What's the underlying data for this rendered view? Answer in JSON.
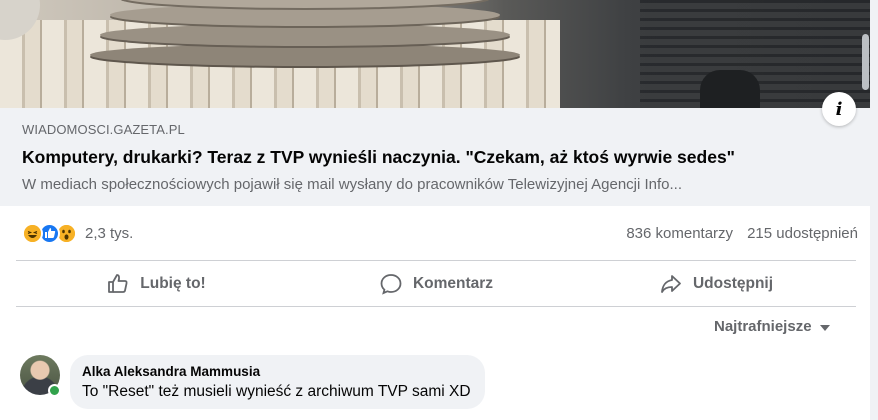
{
  "link_preview": {
    "domain": "WIADOMOSCI.GAZETA.PL",
    "title": "Komputery, drukarki? Teraz z TVP wynieśli naczynia. \"Czekam, aż ktoś wyrwie sedes\"",
    "description": "W mediach społecznościowych pojawił się mail wysłany do pracowników Telewizyjnej Agencji Info...",
    "info_icon": "info-icon"
  },
  "reactions": {
    "icons": [
      "haha-icon",
      "like-icon",
      "wow-icon"
    ],
    "count": "2,3 tys.",
    "comments": "836 komentarzy",
    "shares": "215 udostępnień"
  },
  "actions": {
    "like_label": "Lubię to!",
    "comment_label": "Komentarz",
    "share_label": "Udostępnij"
  },
  "sort": {
    "label": "Najtrafniejsze"
  },
  "comment": {
    "author": "Alka Aleksandra Mammusia",
    "text": "To \"Reset\" też musieli wynieść z archiwum TVP sami XD"
  },
  "colors": {
    "accent": "#1877f2",
    "secondary_text": "#65676b",
    "bubble": "#f0f2f5",
    "online": "#31a24c"
  }
}
